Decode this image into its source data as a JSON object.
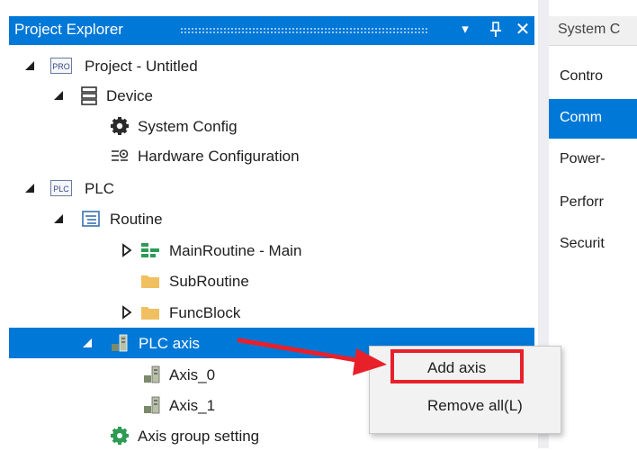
{
  "explorer": {
    "title": "Project Explorer",
    "buttons": {
      "dropdown": "▾",
      "pin": "⫫",
      "close": "✕"
    }
  },
  "tree": {
    "project": {
      "badge": "PRO",
      "label": "Project - Untitled"
    },
    "device": {
      "label": "Device"
    },
    "system_config": {
      "label": "System Config"
    },
    "hardware_config": {
      "label": "Hardware Configuration"
    },
    "plc": {
      "badge": "PLC",
      "label": "PLC"
    },
    "routine": {
      "label": "Routine"
    },
    "main_routine": {
      "label": "MainRoutine - Main"
    },
    "sub_routine": {
      "label": "SubRoutine"
    },
    "func_block": {
      "label": "FuncBlock"
    },
    "plc_axis": {
      "label": "PLC axis"
    },
    "axis_0": {
      "label": "Axis_0"
    },
    "axis_1": {
      "label": "Axis_1"
    },
    "axis_group": {
      "label": "Axis group setting"
    }
  },
  "right_panel": {
    "tab_label": "System C",
    "items": [
      {
        "label": "Contro"
      },
      {
        "label": "Comm"
      },
      {
        "label": "Power-"
      },
      {
        "label": "Perforr"
      },
      {
        "label": "Securit"
      }
    ]
  },
  "context_menu": {
    "items": [
      {
        "label": "Add axis"
      },
      {
        "label": "Remove all(L)"
      }
    ]
  },
  "colors": {
    "accent": "#0078d7",
    "annotation_red": "#e8202a",
    "folder": "#f0c060",
    "routine_green": "#2e9b54"
  }
}
